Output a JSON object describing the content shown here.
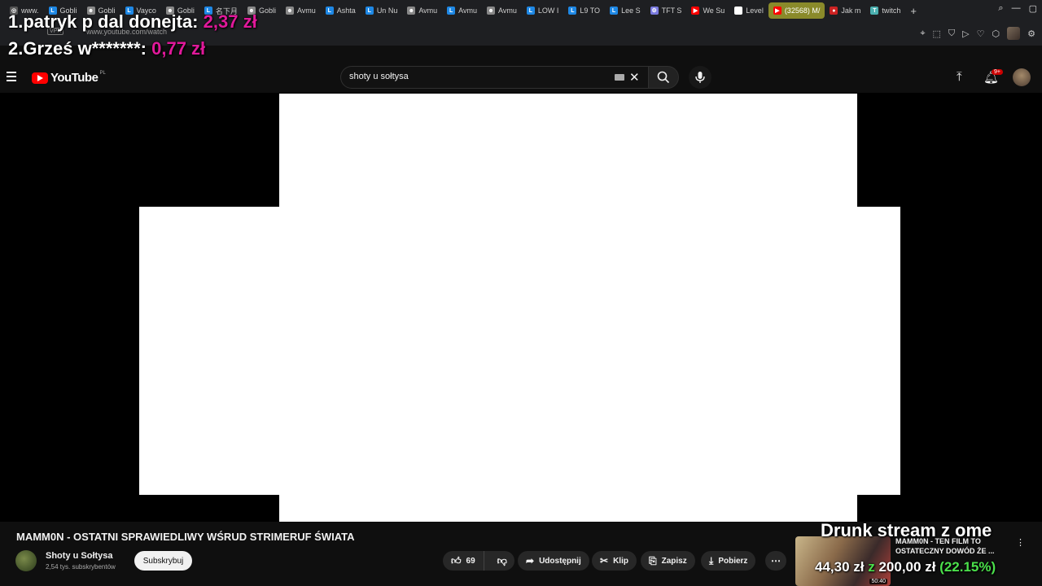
{
  "browser": {
    "tabs": [
      {
        "label": "www.",
        "color": "#555555",
        "glyph": "◎"
      },
      {
        "label": "Gobli",
        "color": "#1e88e5",
        "glyph": "L"
      },
      {
        "label": "Gobli",
        "color": "#888888",
        "glyph": "☻"
      },
      {
        "label": "Vayco",
        "color": "#1e88e5",
        "glyph": "L"
      },
      {
        "label": "Gobli",
        "color": "#888888",
        "glyph": "☻"
      },
      {
        "label": "名下月",
        "color": "#1e88e5",
        "glyph": "L"
      },
      {
        "label": "Gobli",
        "color": "#888888",
        "glyph": "☻"
      },
      {
        "label": "Avmu",
        "color": "#888888",
        "glyph": "☻"
      },
      {
        "label": "Ashta",
        "color": "#1e88e5",
        "glyph": "L"
      },
      {
        "label": "Un Nu",
        "color": "#1e88e5",
        "glyph": "L"
      },
      {
        "label": "Avmu",
        "color": "#888888",
        "glyph": "☻"
      },
      {
        "label": "Avmu",
        "color": "#1e88e5",
        "glyph": "L"
      },
      {
        "label": "Avmu",
        "color": "#888888",
        "glyph": "☻"
      },
      {
        "label": "LOW I",
        "color": "#1e88e5",
        "glyph": "L"
      },
      {
        "label": "L9 TO",
        "color": "#1e88e5",
        "glyph": "L"
      },
      {
        "label": "Lee S",
        "color": "#1e88e5",
        "glyph": "L"
      },
      {
        "label": "TFT S",
        "color": "#7a7adf",
        "glyph": "⚙"
      },
      {
        "label": "We Su",
        "color": "#ff0000",
        "glyph": "▶"
      },
      {
        "label": "Level",
        "color": "#ffffff",
        "glyph": "■"
      },
      {
        "label": "(32568) M/",
        "color": "#ff0000",
        "glyph": "▶",
        "active": true
      },
      {
        "label": "Jak m",
        "color": "#cc2222",
        "glyph": "●"
      },
      {
        "label": "twitch",
        "color": "#4bb0b0",
        "glyph": "T"
      }
    ],
    "new_tab": "+",
    "vpn_label": "VPN",
    "url": "www.youtube.com/watch"
  },
  "overlay": {
    "donations": [
      {
        "rank": "1.",
        "name": "patryk p dal donejta:",
        "amount": "2,37 zł"
      },
      {
        "rank": "2.",
        "name": "Grześ w*******:",
        "amount": "0,77 zł"
      }
    ],
    "stream_title": "Drunk stream z ome",
    "goal": {
      "current": "44,30 zł",
      "of": "z",
      "target": "200,00 zł",
      "percent": "(22.15%)"
    }
  },
  "youtube": {
    "logo_text": "YouTube",
    "country_code": "PL",
    "search_value": "shoty u sołtysa",
    "notifications_badge": "9+"
  },
  "video": {
    "title": "MAMM0N - OSTATNI SPRAWIEDLIWY WŚRUD STRIMERUF ŚWIATA",
    "channel_name": "Shoty u Sołtysa",
    "subscribers": "2,54 tys. subskrybentów",
    "subscribe_label": "Subskrybuj",
    "likes": "69",
    "actions": {
      "share": "Udostępnij",
      "clip": "Klip",
      "save": "Zapisz",
      "download": "Pobierz"
    }
  },
  "recommended": {
    "title": "MAMM0N - TEN FILM TO OSTATECZNY DOWÓD ŻE ...",
    "duration": "50:40"
  }
}
